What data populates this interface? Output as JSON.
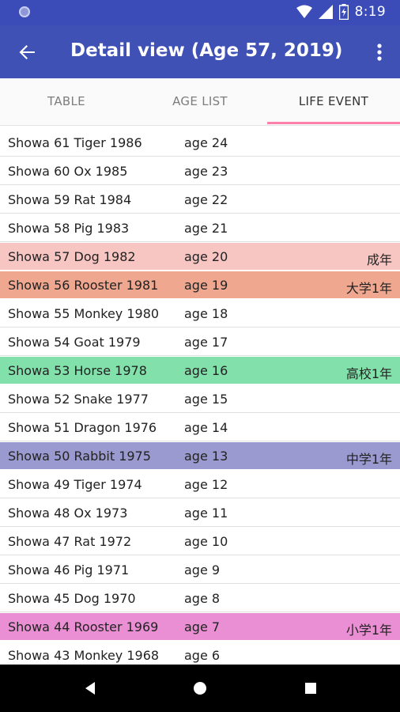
{
  "status": {
    "time": "8:19"
  },
  "appbar": {
    "title": "Detail view (Age 57, 2019)",
    "back_icon": "arrow-back-icon",
    "menu_icon": "more-vert-icon"
  },
  "tabs": [
    {
      "label": "TABLE"
    },
    {
      "label": "AGE LIST"
    },
    {
      "label": "LIFE EVENT",
      "active": true
    }
  ],
  "colors": {
    "accent": "#ff80ab",
    "appbar": "#3f51b5",
    "statusbar": "#3b4cb8"
  },
  "rows": [
    {
      "era": "Showa 61  Tiger 1986",
      "age": "age 24",
      "event": "",
      "color": ""
    },
    {
      "era": "Showa 60  Ox 1985",
      "age": "age 23",
      "event": "",
      "color": ""
    },
    {
      "era": "Showa 59  Rat 1984",
      "age": "age 22",
      "event": "",
      "color": ""
    },
    {
      "era": "Showa 58  Pig 1983",
      "age": "age 21",
      "event": "",
      "color": ""
    },
    {
      "era": "Showa 57  Dog 1982",
      "age": "age 20",
      "event": "成年",
      "color": "#f8c6c2"
    },
    {
      "era": "Showa 56  Rooster 1981",
      "age": "age 19",
      "event": "大学1年",
      "color": "#efa790"
    },
    {
      "era": "Showa 55  Monkey 1980",
      "age": "age 18",
      "event": "",
      "color": ""
    },
    {
      "era": "Showa 54  Goat 1979",
      "age": "age 17",
      "event": "",
      "color": ""
    },
    {
      "era": "Showa 53  Horse 1978",
      "age": "age 16",
      "event": "高校1年",
      "color": "#82e0aa"
    },
    {
      "era": "Showa 52  Snake 1977",
      "age": "age 15",
      "event": "",
      "color": ""
    },
    {
      "era": "Showa 51  Dragon 1976",
      "age": "age 14",
      "event": "",
      "color": ""
    },
    {
      "era": "Showa 50  Rabbit 1975",
      "age": "age 13",
      "event": "中学1年",
      "color": "#9a9ad0"
    },
    {
      "era": "Showa 49  Tiger 1974",
      "age": "age 12",
      "event": "",
      "color": ""
    },
    {
      "era": "Showa 48  Ox 1973",
      "age": "age 11",
      "event": "",
      "color": ""
    },
    {
      "era": "Showa 47  Rat 1972",
      "age": "age 10",
      "event": "",
      "color": ""
    },
    {
      "era": "Showa 46  Pig 1971",
      "age": "age 9",
      "event": "",
      "color": ""
    },
    {
      "era": "Showa 45  Dog 1970",
      "age": "age 8",
      "event": "",
      "color": ""
    },
    {
      "era": "Showa 44  Rooster 1969",
      "age": "age 7",
      "event": "小学1年",
      "color": "#ea8fd3"
    },
    {
      "era": "Showa 43  Monkey 1968",
      "age": "age 6",
      "event": "",
      "color": ""
    }
  ],
  "navbar": {
    "icons": [
      "back-triangle-icon",
      "home-circle-icon",
      "recents-square-icon"
    ]
  }
}
